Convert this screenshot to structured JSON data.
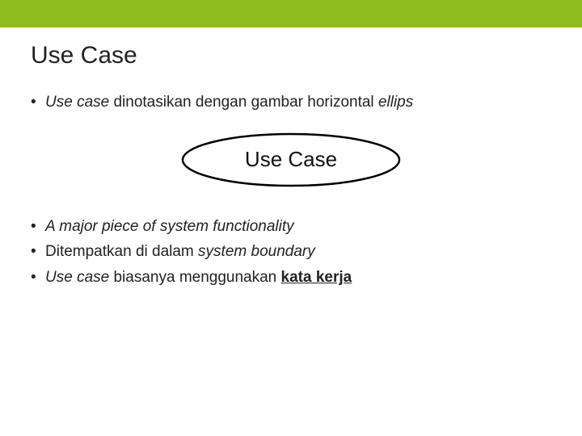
{
  "title": "Use Case",
  "bullets_top": [
    {
      "prefix_italic": "Use case",
      "rest": " dinotasikan dengan gambar horizontal ",
      "suffix_italic": "ellips"
    }
  ],
  "ellipse_label": "Use Case",
  "bullets_bottom": [
    {
      "full_italic": "A major piece of system functionality"
    },
    {
      "plain_before": "Ditempatkan di dalam ",
      "italic_tail": "system boundary"
    },
    {
      "italic_head": "Use case",
      "plain_mid": " biasanya menggunakan ",
      "bold_underline_tail": "kata kerja"
    }
  ]
}
